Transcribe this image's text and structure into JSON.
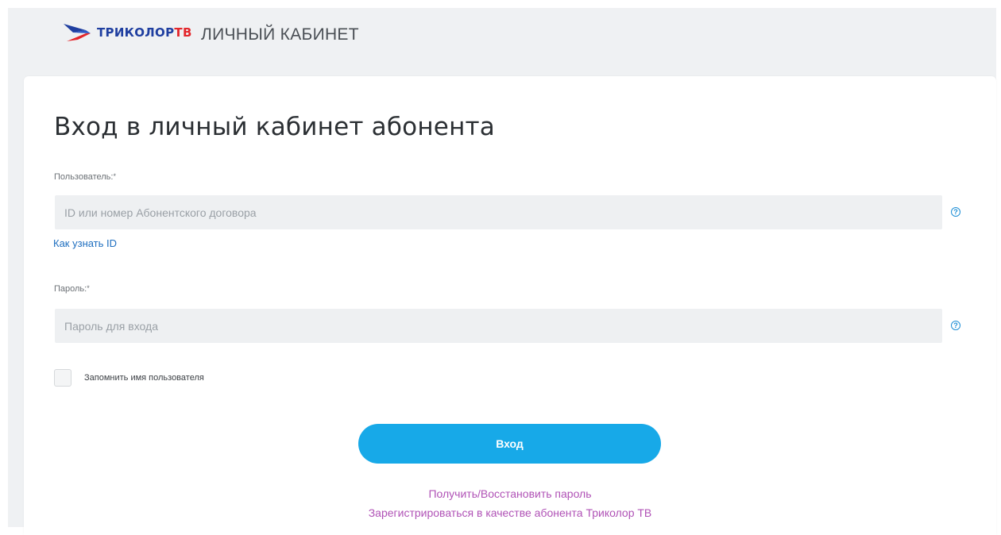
{
  "header": {
    "logo_main": "ТРИКОЛОР",
    "logo_suffix": "ТВ",
    "title": "ЛИЧНЫЙ КАБИНЕТ"
  },
  "form": {
    "title": "Вход в личный кабинет абонента",
    "user_label": "Пользователь:",
    "user_placeholder": "ID или номер Абонентского договора",
    "how_to_find_id": "Как узнать ID",
    "password_label": "Пароль:",
    "password_placeholder": "Пароль для входа",
    "required_mark": "*",
    "remember_label": "Запомнить имя пользователя",
    "help_glyph": "?",
    "login_button": "Вход",
    "recover_link": "Получить/Восстановить пароль",
    "register_link": "Зарегистрироваться в качестве абонента Триколор ТВ"
  },
  "colors": {
    "brand_blue": "#1f3fa0",
    "brand_red": "#e3262b",
    "accent_button": "#17a9e8",
    "link_blue": "#1f6fc0",
    "link_purple": "#b052b6"
  },
  "icons": [
    "tricolor-logo-icon",
    "help-circle-icon",
    "checkbox-icon"
  ]
}
